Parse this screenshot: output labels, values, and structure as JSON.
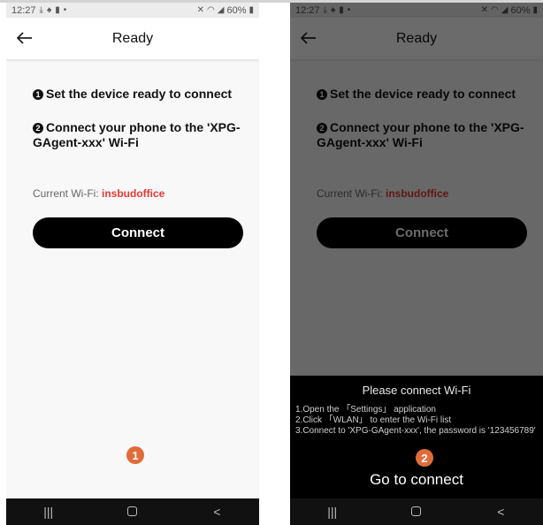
{
  "status_bar": {
    "time": "12:27",
    "battery": "60%"
  },
  "nav": {
    "title": "Ready"
  },
  "steps": [
    {
      "num": "1",
      "text": "Set the device ready to connect"
    },
    {
      "num": "2",
      "text": "Connect your phone to the 'XPG-GAgent-xxx' Wi-Fi"
    }
  ],
  "wifi": {
    "label": "Current Wi-Fi: ",
    "name": "insbudoffice"
  },
  "connect_label": "Connect",
  "badges": {
    "left": "1",
    "right": "2"
  },
  "sheet": {
    "title": "Please connect Wi-Fi",
    "line1": "1.Open the 「Settings」 application",
    "line2": "2.Click 「WLAN」 to enter the Wi-Fi list",
    "line3": "3.Connect to 'XPG-GAgent-xxx', the password is '123456789'",
    "goto_label": "Go to connect"
  },
  "colors": {
    "accent_red": "#e53935",
    "badge_orange": "#e06c3a"
  },
  "icons": [
    "back-arrow-icon",
    "download-icon",
    "notification-icon",
    "sim-icon",
    "mute-icon",
    "wifi-icon",
    "signal-icon",
    "battery-icon",
    "recents-icon",
    "home-icon",
    "back-nav-icon"
  ]
}
